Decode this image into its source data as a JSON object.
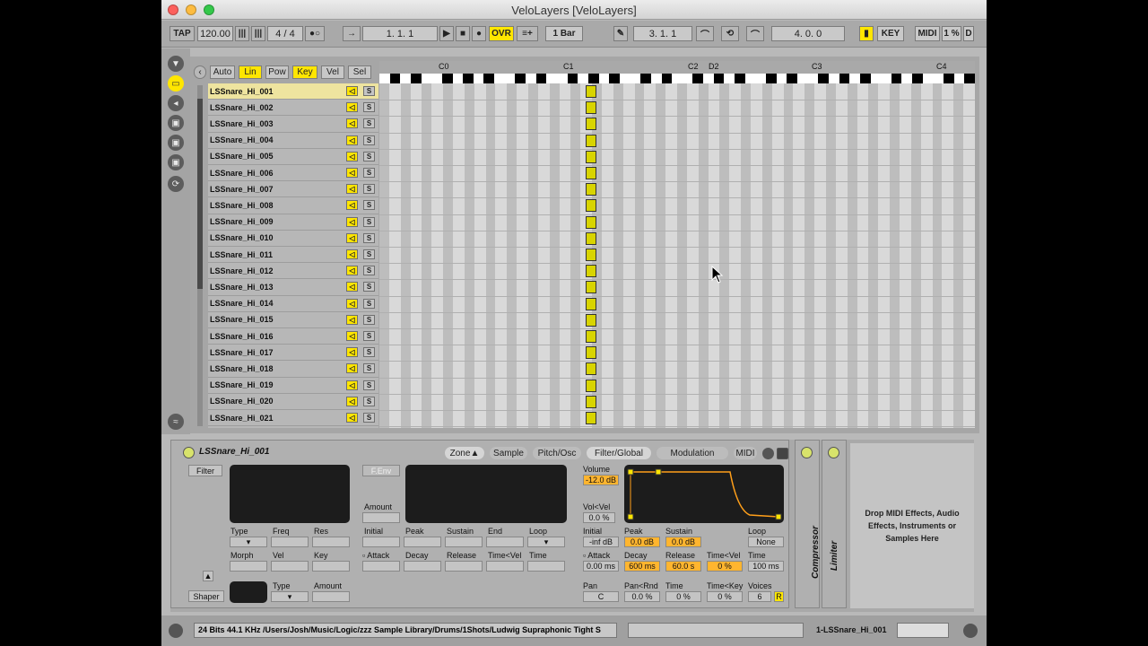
{
  "window": {
    "title": "VeloLayers  [VeloLayers]"
  },
  "transport": {
    "tap": "TAP",
    "tempo": "120.00",
    "signature": "4 / 4",
    "position": "1.   1.   1",
    "ovr": "OVR",
    "quantize": "1 Bar",
    "loop_start": "3.   1.   1",
    "loop_length": "4.   0.   0",
    "key": "KEY",
    "midi": "MIDI",
    "cpu": "1 %",
    "d": "D"
  },
  "modes": {
    "auto": "Auto",
    "lin": "Lin",
    "pow": "Pow",
    "key": "Key",
    "vel": "Vel",
    "sel": "Sel"
  },
  "ruler": [
    "C0",
    "C1",
    "C2",
    "D2",
    "C3",
    "C4"
  ],
  "rows": [
    "LSSnare_Hi_001",
    "LSSnare_Hi_002",
    "LSSnare_Hi_003",
    "LSSnare_Hi_004",
    "LSSnare_Hi_005",
    "LSSnare_Hi_006",
    "LSSnare_Hi_007",
    "LSSnare_Hi_008",
    "LSSnare_Hi_009",
    "LSSnare_Hi_010",
    "LSSnare_Hi_011",
    "LSSnare_Hi_012",
    "LSSnare_Hi_013",
    "LSSnare_Hi_014",
    "LSSnare_Hi_015",
    "LSSnare_Hi_016",
    "LSSnare_Hi_017",
    "LSSnare_Hi_018",
    "LSSnare_Hi_019",
    "LSSnare_Hi_020",
    "LSSnare_Hi_021"
  ],
  "row_speaker": "◁",
  "row_solo": "S",
  "device": {
    "name": "LSSnare_Hi_001",
    "tabs": {
      "zone": "Zone",
      "sample": "Sample",
      "pitch": "Pitch/Osc",
      "filter": "Filter/Global",
      "modulation": "Modulation",
      "midi": "MIDI"
    },
    "filter": "Filter",
    "fenv": "F.Env",
    "amount": "Amount",
    "type": "Type",
    "freq": "Freq",
    "res": "Res",
    "morph": "Morph",
    "vel": "Vel",
    "key": "Key",
    "initial": "Initial",
    "peak": "Peak",
    "sustain": "Sustain",
    "end": "End",
    "loop": "Loop",
    "attack": "Attack",
    "decay": "Decay",
    "release": "Release",
    "time_vel": "Time<Vel",
    "time": "Time",
    "shaper": "Shaper",
    "type2": "Type",
    "amount2": "Amount",
    "volume_label": "Volume",
    "volume": "-12.0 dB",
    "volvel_label": "Vol<Vel",
    "volvel": "0.0 %",
    "amp": {
      "initial": "Initial",
      "initial_val": "-inf dB",
      "peak": "Peak",
      "peak_val": "0.0 dB",
      "sustain": "Sustain",
      "sustain_val": "0.0 dB",
      "loop": "Loop",
      "loop_val": "None",
      "attack": "Attack",
      "attack_val": "0.00 ms",
      "decay": "Decay",
      "decay_val": "600 ms",
      "release": "Release",
      "release_val": "60.0 s",
      "timevel": "Time<Vel",
      "timevel_val": "0 %",
      "time": "Time",
      "time_val": "100 ms",
      "pan": "Pan",
      "pan_val": "C",
      "panrnd": "Pan<Rnd",
      "panrnd_val": "0.0 %",
      "time2": "Time",
      "time2_val": "0 %",
      "timekey": "Time<Key",
      "timekey_val": "0 %",
      "voices": "Voices",
      "voices_val": "6",
      "r": "R"
    }
  },
  "compressor": "Compressor",
  "limiter": "Limiter",
  "drop_text": "Drop MIDI Effects, Audio Effects, Instruments or Samples Here",
  "status": {
    "path": "24 Bits 44.1 KHz /Users/Josh/Music/Logic/zzz Sample Library/Drums/1Shots/Ludwig Supraphonic Tight S",
    "track": "1-LSSnare_Hi_001"
  },
  "colors": {
    "accent": "#ffe600",
    "envelope": "#ff9f1a",
    "selected_row": "#eee49f"
  }
}
